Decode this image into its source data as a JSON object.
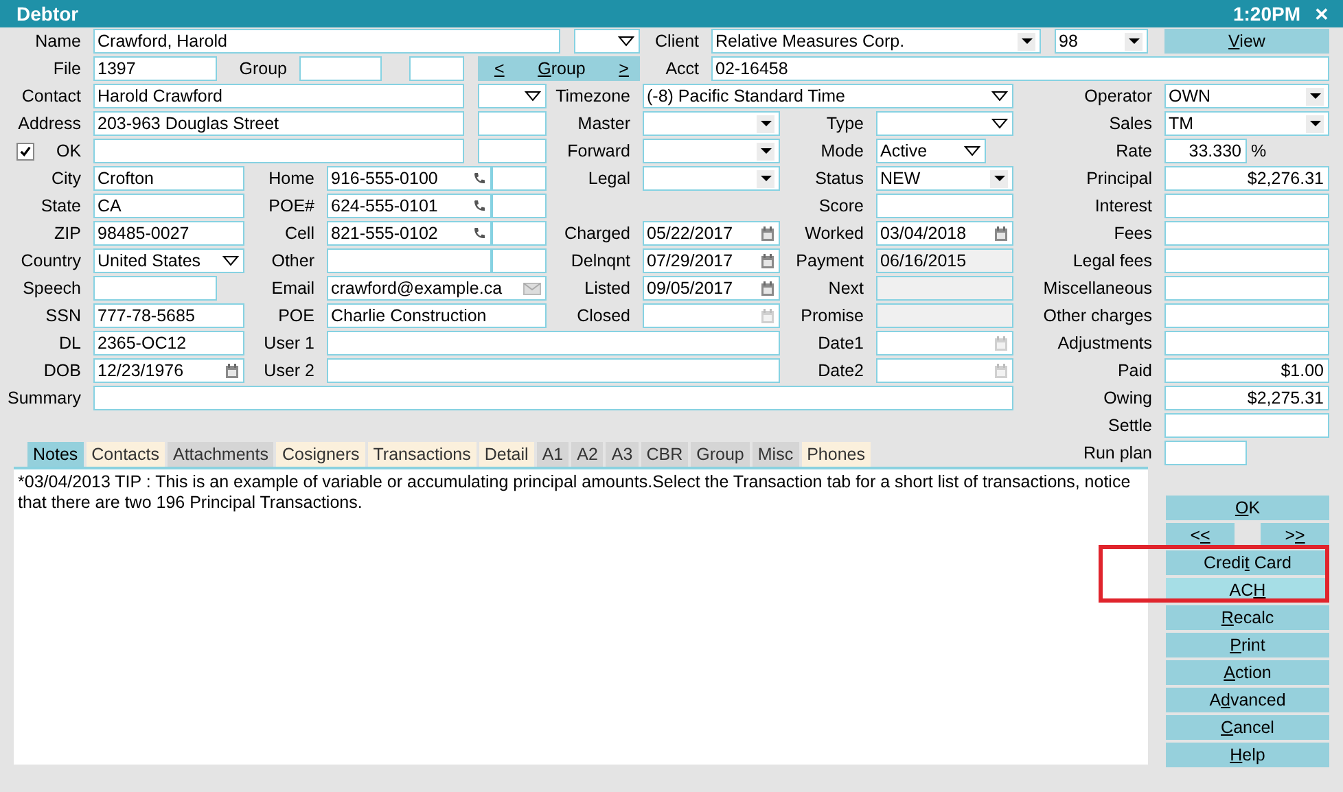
{
  "window": {
    "title": "Debtor",
    "time": "1:20PM",
    "close": "✕"
  },
  "form": {
    "fields": [
      {
        "label": "Name",
        "kind": "field",
        "value": "Crawford, Harold"
      },
      {
        "kind": "combo"
      },
      {
        "label": "Client",
        "kind": "dropdown",
        "value": "Relative Measures Corp."
      },
      {
        "kind": "dropdown",
        "value": "98"
      },
      {
        "kind": "button",
        "text": "View"
      },
      {
        "label": "File",
        "kind": "field",
        "value": "1397"
      },
      {
        "label": "Group",
        "kind": "field"
      },
      {
        "kind": "field"
      },
      {
        "kind": "groupbutton",
        "prev": "<",
        "text": "Group",
        "next": ">"
      },
      {
        "label": "Acct",
        "kind": "field",
        "value": "02-16458"
      },
      {
        "label": "Contact",
        "kind": "field",
        "value": "Harold Crawford"
      },
      {
        "kind": "combo"
      },
      {
        "label": "Timezone",
        "kind": "combo",
        "value": "(-8) Pacific Standard Time"
      },
      {
        "label": "Address",
        "kind": "field",
        "value": "203-963 Douglas Street"
      },
      {
        "kind": "field"
      },
      {
        "label": "Master",
        "kind": "dropdown"
      },
      {
        "label": "Type",
        "kind": "combo"
      },
      {
        "label": "OK",
        "kind": "check",
        "checked": true
      },
      {
        "kind": "field"
      },
      {
        "kind": "field"
      },
      {
        "label": "Forward",
        "kind": "dropdown"
      },
      {
        "label": "Mode",
        "kind": "combo",
        "value": "Active"
      },
      {
        "label": "City",
        "kind": "field",
        "value": "Crofton"
      },
      {
        "label": "Home",
        "kind": "phone",
        "value": "916-555-0100"
      },
      {
        "kind": "field"
      },
      {
        "label": "Legal",
        "kind": "dropdown"
      },
      {
        "label": "Status",
        "kind": "dropdown",
        "value": "NEW"
      },
      {
        "label": "State",
        "kind": "field",
        "value": "CA"
      },
      {
        "label": "POE#",
        "kind": "phone",
        "value": "624-555-0101"
      },
      {
        "kind": "field"
      },
      {
        "label": "Score",
        "kind": "field"
      },
      {
        "label": "ZIP",
        "kind": "field",
        "value": "98485-0027"
      },
      {
        "label": "Cell",
        "kind": "phone",
        "value": "821-555-0102"
      },
      {
        "kind": "field"
      },
      {
        "label": "Charged",
        "kind": "date",
        "value": "05/22/2017"
      },
      {
        "label": "Worked",
        "kind": "date",
        "value": "03/04/2018"
      },
      {
        "label": "Country",
        "kind": "combo",
        "value": "United States"
      },
      {
        "label": "Other",
        "kind": "field"
      },
      {
        "kind": "field"
      },
      {
        "label": "Delnqnt",
        "kind": "date",
        "value": "07/29/2017"
      },
      {
        "label": "Payment",
        "kind": "readonly",
        "value": "06/16/2015"
      },
      {
        "label": "Speech",
        "kind": "field"
      },
      {
        "label": "Email",
        "kind": "email",
        "value": "crawford@example.ca"
      },
      {
        "label": "Listed",
        "kind": "date",
        "value": "09/05/2017"
      },
      {
        "label": "Next",
        "kind": "readonly"
      },
      {
        "label": "SSN",
        "kind": "field",
        "value": "777-78-5685"
      },
      {
        "label": "POE",
        "kind": "field",
        "value": "Charlie Construction"
      },
      {
        "label": "Closed",
        "kind": "date"
      },
      {
        "label": "Promise",
        "kind": "readonly"
      },
      {
        "label": "DL",
        "kind": "field",
        "value": "2365-OC12"
      },
      {
        "label": "User 1",
        "kind": "field"
      },
      {
        "label": "Date1",
        "kind": "date"
      },
      {
        "label": "DOB",
        "kind": "date",
        "value": "12/23/1976"
      },
      {
        "label": "User 2",
        "kind": "field"
      },
      {
        "label": "Date2",
        "kind": "date"
      },
      {
        "label": "Summary",
        "kind": "field"
      }
    ]
  },
  "totals": [
    {
      "label": "Operator",
      "kind": "dropdown",
      "value": "OWN"
    },
    {
      "label": "Sales",
      "kind": "dropdown",
      "value": "TM"
    },
    {
      "label": "Rate",
      "kind": "amount",
      "value": "33.330",
      "unit": "%"
    },
    {
      "label": "Principal",
      "kind": "amount",
      "value": "$2,276.31"
    },
    {
      "label": "Interest",
      "kind": "amount"
    },
    {
      "label": "Fees",
      "kind": "amount"
    },
    {
      "label": "Legal fees",
      "kind": "amount"
    },
    {
      "label": "Miscellaneous",
      "kind": "amount"
    },
    {
      "label": "Other charges",
      "kind": "amount"
    },
    {
      "label": "Adjustments",
      "kind": "amount"
    },
    {
      "label": "Paid",
      "kind": "amount",
      "value": "$1.00"
    },
    {
      "label": "Owing",
      "kind": "amount",
      "value": "$2,275.31"
    },
    {
      "label": "Settle",
      "kind": "amount"
    },
    {
      "label": "Run plan",
      "kind": "field"
    }
  ],
  "tabs": [
    {
      "label": "Notes",
      "selected": true,
      "filled": true
    },
    {
      "label": "Contacts",
      "selected": false,
      "filled": true
    },
    {
      "label": "Attachments",
      "selected": false,
      "filled": false
    },
    {
      "label": "Cosigners",
      "selected": false,
      "filled": true
    },
    {
      "label": "Transactions",
      "selected": false,
      "filled": true
    },
    {
      "label": "Detail",
      "selected": false,
      "filled": true
    },
    {
      "label": "A1",
      "selected": false,
      "filled": false
    },
    {
      "label": "A2",
      "selected": false,
      "filled": false
    },
    {
      "label": "A3",
      "selected": false,
      "filled": false
    },
    {
      "label": "CBR",
      "selected": false,
      "filled": false
    },
    {
      "label": "Group",
      "selected": false,
      "filled": false
    },
    {
      "label": "Misc",
      "selected": false,
      "filled": false
    },
    {
      "label": "Phones",
      "selected": false,
      "filled": true
    }
  ],
  "notes": "*03/04/2013 TIP : This is an example of variable or accumulating principal amounts.Select the Transaction tab for a short list of transactions, notice that there are two 196 Principal Transactions.",
  "buttons": [
    [
      {
        "label": "OK",
        "highlighted": false
      }
    ],
    [
      {
        "label": "<<",
        "highlighted": false
      },
      {
        "label": ">>",
        "highlighted": false
      }
    ],
    [
      {
        "label": "Credit Card",
        "highlighted": false
      }
    ],
    [
      {
        "label": "ACH",
        "highlighted": true
      }
    ],
    [
      {
        "label": "Recalc",
        "highlighted": false
      }
    ],
    [
      {
        "label": "Print",
        "highlighted": false
      }
    ],
    [
      {
        "label": "Action",
        "highlighted": false
      }
    ],
    [
      {
        "label": "Advanced",
        "highlighted": false
      }
    ],
    [
      {
        "label": "Cancel",
        "highlighted": false
      }
    ],
    [
      {
        "label": "Help",
        "highlighted": false
      }
    ]
  ]
}
